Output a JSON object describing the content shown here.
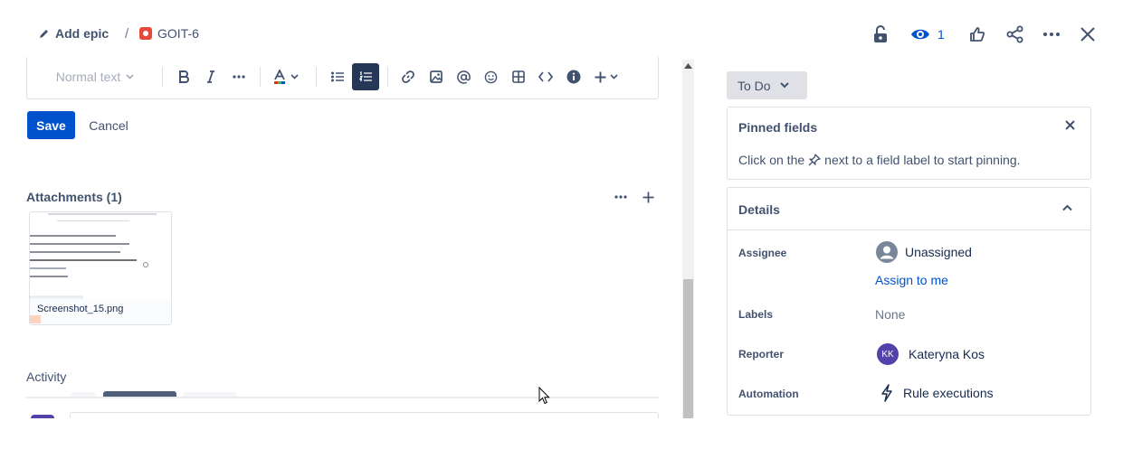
{
  "header": {
    "add_epic": "Add epic",
    "separator": "/",
    "issue_key": "GOIT-6",
    "watchers_count": "1"
  },
  "editor": {
    "text_style": "Normal text"
  },
  "actions": {
    "save": "Save",
    "cancel": "Cancel"
  },
  "attachments": {
    "title": "Attachments (1)",
    "file_name": "Screenshot_15.png"
  },
  "activity": {
    "title": "Activity"
  },
  "status": {
    "label": "To Do"
  },
  "pinned": {
    "title": "Pinned fields",
    "hint_before": "Click on the",
    "hint_after": "next to a field label to start pinning."
  },
  "details": {
    "title": "Details",
    "assignee_label": "Assignee",
    "assignee_value": "Unassigned",
    "assign_to_me": "Assign to me",
    "labels_label": "Labels",
    "labels_value": "None",
    "reporter_label": "Reporter",
    "reporter_initials": "KK",
    "reporter_name": "Kateryna Kos",
    "automation_label": "Automation",
    "automation_value": "Rule executions"
  },
  "colors": {
    "primary": "#0052cc",
    "issue_type": "#e5493a",
    "reporter_avatar": "#5243aa",
    "active_tool": "#253858"
  }
}
